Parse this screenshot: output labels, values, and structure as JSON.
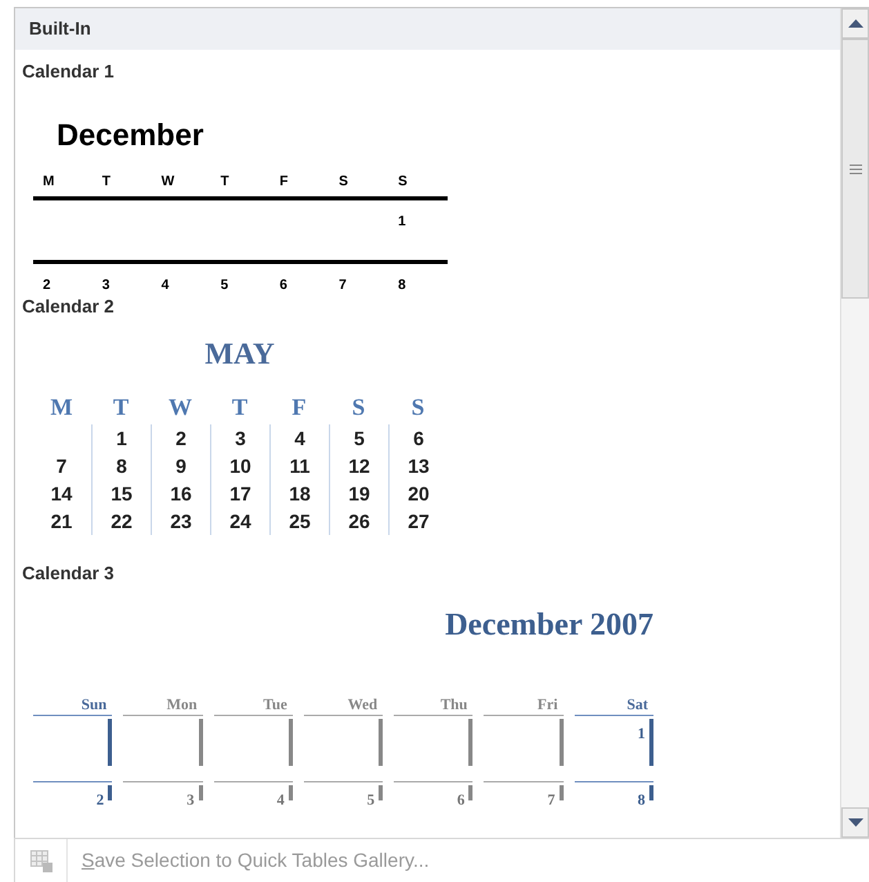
{
  "header": {
    "title": "Built-In"
  },
  "calendars": [
    {
      "kind": "lined",
      "title": "Calendar 1",
      "month": "December",
      "columns": [
        {
          "weekday": "M",
          "weekend": false,
          "blank_first": true,
          "days": [
            "2"
          ]
        },
        {
          "weekday": "T",
          "weekend": false,
          "blank_first": true,
          "days": [
            "3"
          ]
        },
        {
          "weekday": "W",
          "weekend": false,
          "blank_first": true,
          "days": [
            "4"
          ]
        },
        {
          "weekday": "T",
          "weekend": false,
          "blank_first": true,
          "days": [
            "5"
          ]
        },
        {
          "weekday": "F",
          "weekend": false,
          "blank_first": true,
          "days": [
            "6"
          ]
        },
        {
          "weekday": "S",
          "weekend": false,
          "blank_first": true,
          "days": [
            "7"
          ]
        },
        {
          "weekday": "S",
          "weekend": false,
          "blank_first": false,
          "days": [
            "1",
            "8"
          ]
        }
      ]
    },
    {
      "kind": "grid",
      "title": "Calendar 2",
      "month": "MAY",
      "columns": [
        {
          "weekday": "M",
          "weekend": false,
          "blank_first": true,
          "days": [
            "7",
            "14",
            "21"
          ]
        },
        {
          "weekday": "T",
          "weekend": false,
          "blank_first": false,
          "days": [
            "1",
            "8",
            "15",
            "22"
          ]
        },
        {
          "weekday": "W",
          "weekend": false,
          "blank_first": false,
          "days": [
            "2",
            "9",
            "16",
            "23"
          ]
        },
        {
          "weekday": "T",
          "weekend": false,
          "blank_first": false,
          "days": [
            "3",
            "10",
            "17",
            "24"
          ]
        },
        {
          "weekday": "F",
          "weekend": false,
          "blank_first": false,
          "days": [
            "4",
            "11",
            "18",
            "25"
          ]
        },
        {
          "weekday": "S",
          "weekend": false,
          "blank_first": false,
          "days": [
            "5",
            "12",
            "19",
            "26"
          ]
        },
        {
          "weekday": "S",
          "weekend": false,
          "blank_first": false,
          "days": [
            "6",
            "13",
            "20",
            "27"
          ]
        }
      ]
    },
    {
      "kind": "boxed",
      "title": "Calendar 3",
      "month": "December 2007",
      "columns": [
        {
          "weekday": "Sun",
          "weekend": true,
          "blank_first": true,
          "days": [
            "2"
          ]
        },
        {
          "weekday": "Mon",
          "weekend": false,
          "blank_first": true,
          "days": [
            "3"
          ]
        },
        {
          "weekday": "Tue",
          "weekend": false,
          "blank_first": true,
          "days": [
            "4"
          ]
        },
        {
          "weekday": "Wed",
          "weekend": false,
          "blank_first": true,
          "days": [
            "5"
          ]
        },
        {
          "weekday": "Thu",
          "weekend": false,
          "blank_first": true,
          "days": [
            "6"
          ]
        },
        {
          "weekday": "Fri",
          "weekend": false,
          "blank_first": true,
          "days": [
            "7"
          ]
        },
        {
          "weekday": "Sat",
          "weekend": true,
          "blank_first": false,
          "days": [
            "1",
            "8"
          ]
        }
      ]
    }
  ],
  "footer": {
    "label": "Save Selection to Quick Tables Gallery...",
    "disabled": true
  }
}
